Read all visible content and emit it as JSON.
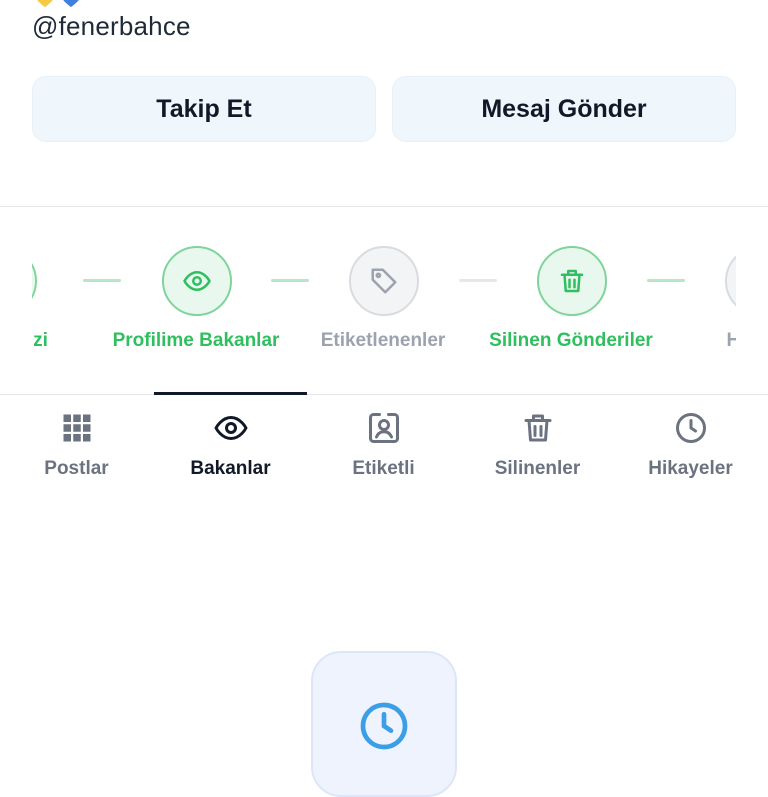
{
  "profile": {
    "handle": "@fenerbahce",
    "emoji_hearts": [
      "yellow-heart",
      "blue-heart"
    ]
  },
  "actions": {
    "follow_label": "Takip Et",
    "message_label": "Mesaj Gönder"
  },
  "features": {
    "items": [
      {
        "label": "alizi",
        "icon": "chart-icon",
        "state": "active"
      },
      {
        "label": "Profilime Bakanlar",
        "icon": "eye-icon",
        "state": "active"
      },
      {
        "label": "Etiketlenenler",
        "icon": "tag-icon",
        "state": "inactive"
      },
      {
        "label": "Silinen Gönderiler",
        "icon": "trash-icon",
        "state": "active"
      },
      {
        "label": "Hi",
        "icon": "clock-icon",
        "state": "inactive"
      }
    ]
  },
  "tabs": {
    "items": [
      {
        "label": "Postlar",
        "icon": "grid-icon"
      },
      {
        "label": "Bakanlar",
        "icon": "eye-icon"
      },
      {
        "label": "Etiketli",
        "icon": "tagged-user-icon"
      },
      {
        "label": "Silinenler",
        "icon": "trash-icon"
      },
      {
        "label": "Hikayeler",
        "icon": "clock-icon"
      }
    ],
    "active": "Bakanlar"
  },
  "empty_state": {
    "icon": "clock-icon"
  },
  "colors": {
    "accent_green": "#2fbf5f",
    "accent_blue": "#3b9ee6",
    "button_bg": "#eff6fc",
    "muted": "#6b7280"
  }
}
